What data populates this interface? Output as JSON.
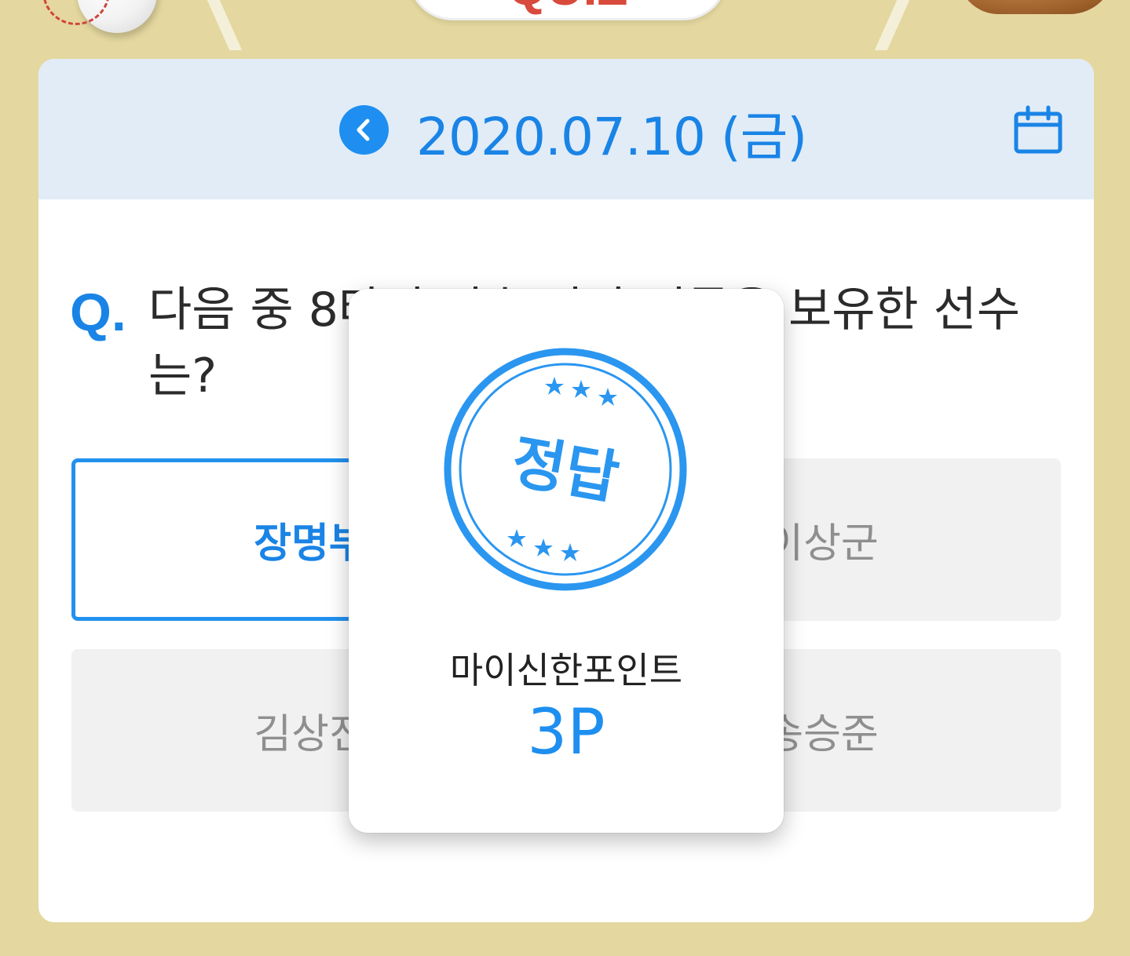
{
  "header": {
    "banner_text": "QUIZ"
  },
  "date_nav": {
    "date": "2020.07.10 (금)"
  },
  "question": {
    "q_mark": "Q.",
    "text": "다음 중 8타점 연속 안타 기록을 보유한 선수는?"
  },
  "options": [
    {
      "label": "장명부",
      "selected": true
    },
    {
      "label": "이상군",
      "selected": false
    },
    {
      "label": "김상진",
      "selected": false
    },
    {
      "label": "송승준",
      "selected": false
    }
  ],
  "result_modal": {
    "stamp_text": "정답",
    "reward_label": "마이신한포인트",
    "reward_points": "3P"
  },
  "colors": {
    "background": "#e4d79f",
    "accent": "#1e8ff0",
    "header_bg": "#e1ecf7",
    "option_bg": "#f1f1f1"
  },
  "icons": {
    "prev": "chevron-left-icon",
    "calendar": "calendar-icon",
    "stamp": "stamp-icon"
  }
}
